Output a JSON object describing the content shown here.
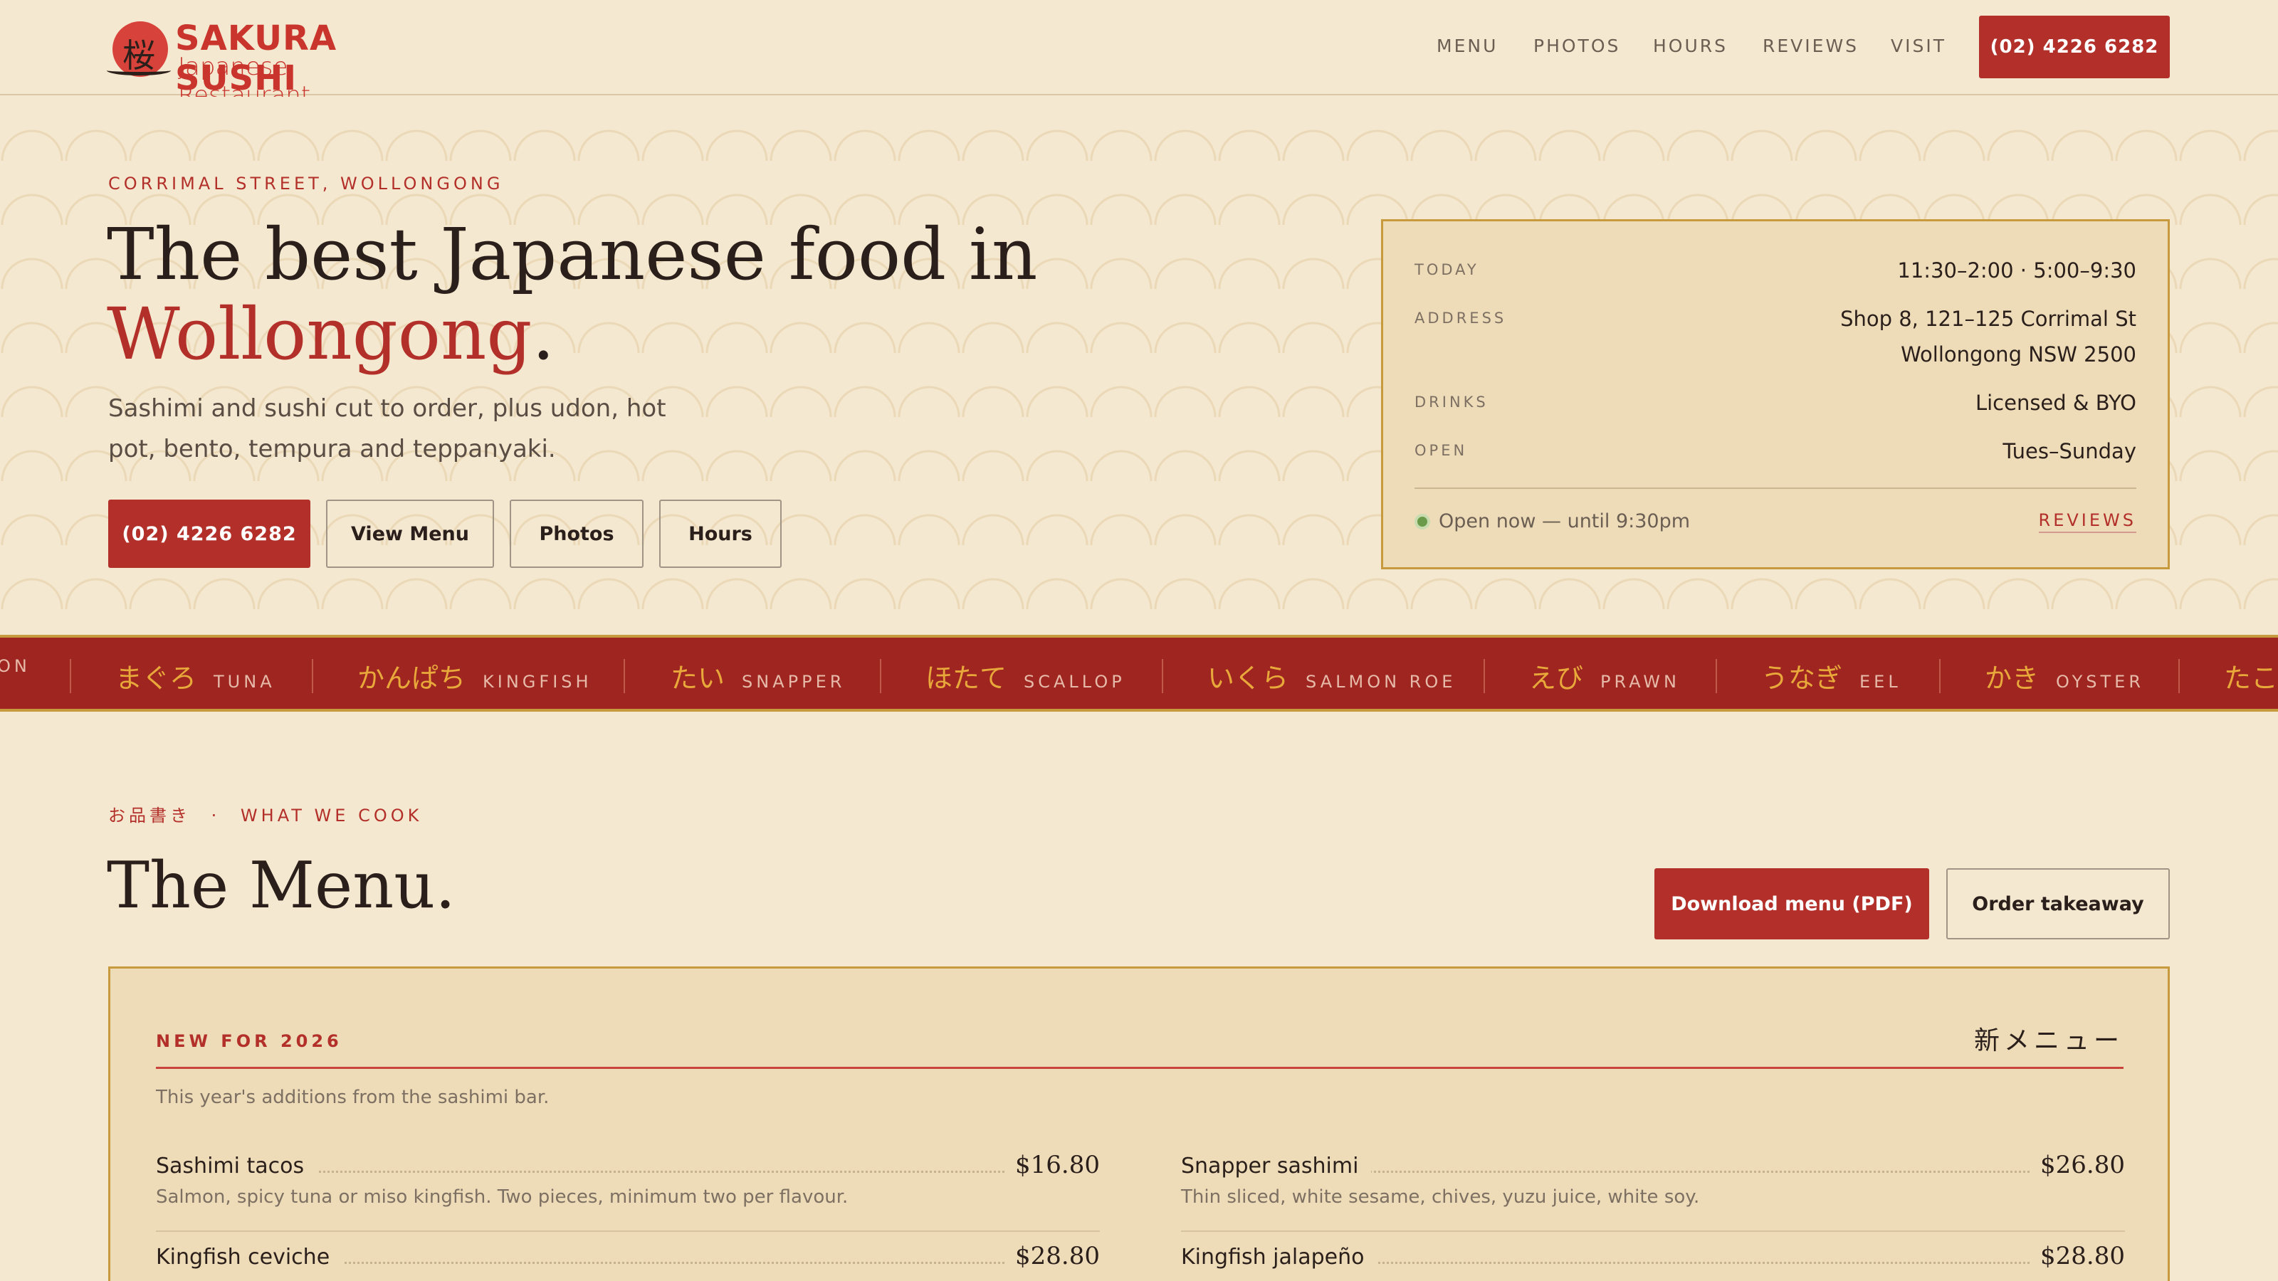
{
  "brand": {
    "name": "SAKURA SUSHI",
    "tagline": "Japanese Restaurant",
    "mark_glyph": "桜",
    "accent_color": "#b3302a"
  },
  "nav": {
    "items": [
      "MENU",
      "PHOTOS",
      "HOURS",
      "REVIEWS",
      "VISIT"
    ],
    "phone": "(02) 4226 6282"
  },
  "hero": {
    "kicker": "CORRIMAL STREET, WOLLONGONG",
    "title_line1": "The best Japanese food in",
    "title_accent": "Wollongong",
    "title_end": ".",
    "subtitle": "Sashimi and sushi cut to order, plus udon, hot pot, bento, tempura and teppanyaki.",
    "buttons": {
      "call": "(02) 4226 6282",
      "menu": "View Menu",
      "photos": "Photos",
      "hours": "Hours"
    }
  },
  "info_card": {
    "today_label": "TODAY",
    "today_value": "11:30–2:00 · 5:00–9:30",
    "address_label": "ADDRESS",
    "address_line1": "Shop 8, 121–125 Corrimal St",
    "address_line2": "Wollongong NSW 2500",
    "drinks_label": "DRINKS",
    "drinks_value": "Licensed & BYO",
    "open_label": "OPEN",
    "open_value": "Tues–Sunday",
    "status": "Open now — until 9:30pm",
    "reviews_link": "REVIEWS"
  },
  "ticker": {
    "lead_fragment": "ON",
    "items": [
      {
        "jp": "まぐろ",
        "en": "TUNA"
      },
      {
        "jp": "かんぱち",
        "en": "KINGFISH"
      },
      {
        "jp": "たい",
        "en": "SNAPPER"
      },
      {
        "jp": "ほたて",
        "en": "SCALLOP"
      },
      {
        "jp": "いくら",
        "en": "SALMON ROE"
      },
      {
        "jp": "えび",
        "en": "PRAWN"
      },
      {
        "jp": "うなぎ",
        "en": "EEL"
      },
      {
        "jp": "かき",
        "en": "OYSTER"
      }
    ],
    "trail_fragment": "たこ"
  },
  "menu_section": {
    "kicker_jp": "お品書き",
    "kicker_sep": "·",
    "kicker_en": "WHAT WE COOK",
    "title": "The Menu.",
    "download_button": "Download menu (PDF)",
    "order_button": "Order takeaway"
  },
  "menu_card": {
    "kicker": "NEW FOR 2026",
    "jp_title": "新メニュー",
    "description": "This year's additions from the sashimi bar.",
    "dishes": [
      {
        "name": "Sashimi tacos",
        "price": "$16.80",
        "note": "Salmon, spicy tuna or miso kingfish. Two pieces, minimum two per flavour."
      },
      {
        "name": "Snapper sashimi",
        "price": "$26.80",
        "note": "Thin sliced, white sesame, chives, yuzu juice, white soy."
      },
      {
        "name": "Kingfish ceviche",
        "price": "$28.80",
        "note": ""
      },
      {
        "name": "Kingfish jalapeño",
        "price": "$28.80",
        "note": ""
      }
    ]
  }
}
